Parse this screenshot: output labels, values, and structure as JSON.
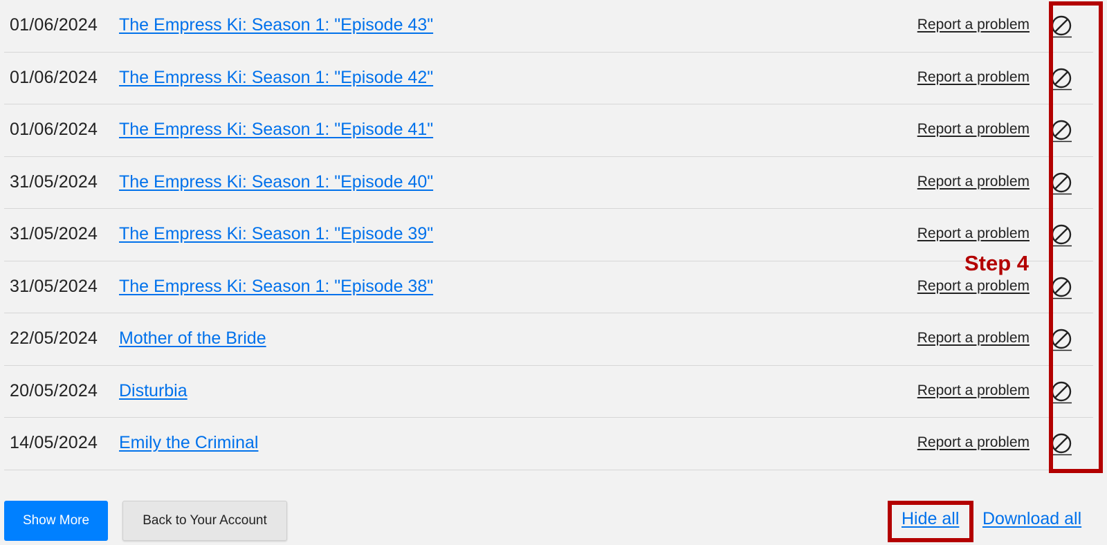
{
  "rows": [
    {
      "date": "01/06/2024",
      "title": "The Empress Ki: Season 1: \"Episode 43\"",
      "report": "Report a problem",
      "hide_icon": "hide-circle-slash-icon"
    },
    {
      "date": "01/06/2024",
      "title": "The Empress Ki: Season 1: \"Episode 42\"",
      "report": "Report a problem",
      "hide_icon": "hide-circle-slash-icon"
    },
    {
      "date": "01/06/2024",
      "title": "The Empress Ki: Season 1: \"Episode 41\"",
      "report": "Report a problem",
      "hide_icon": "hide-circle-slash-icon"
    },
    {
      "date": "31/05/2024",
      "title": "The Empress Ki: Season 1: \"Episode 40\"",
      "report": "Report a problem",
      "hide_icon": "hide-circle-slash-icon"
    },
    {
      "date": "31/05/2024",
      "title": "The Empress Ki: Season 1: \"Episode 39\"",
      "report": "Report a problem",
      "hide_icon": "hide-circle-slash-icon"
    },
    {
      "date": "31/05/2024",
      "title": "The Empress Ki: Season 1: \"Episode 38\"",
      "report": "Report a problem",
      "hide_icon": "hide-circle-slash-icon"
    },
    {
      "date": "22/05/2024",
      "title": "Mother of the Bride",
      "report": "Report a problem",
      "hide_icon": "hide-circle-slash-icon"
    },
    {
      "date": "20/05/2024",
      "title": "Disturbia",
      "report": "Report a problem",
      "hide_icon": "hide-circle-slash-icon"
    },
    {
      "date": "14/05/2024",
      "title": "Emily the Criminal",
      "report": "Report a problem",
      "hide_icon": "hide-circle-slash-icon"
    }
  ],
  "annotation": {
    "step_label": "Step 4",
    "highlight_color": "#b30000"
  },
  "footer": {
    "show_more": "Show More",
    "back_to_account": "Back to Your Account",
    "hide_all": "Hide all",
    "download_all": "Download all"
  },
  "colors": {
    "link": "#0071eb",
    "primary_button": "#0080ff",
    "background": "#f2f2f2"
  }
}
